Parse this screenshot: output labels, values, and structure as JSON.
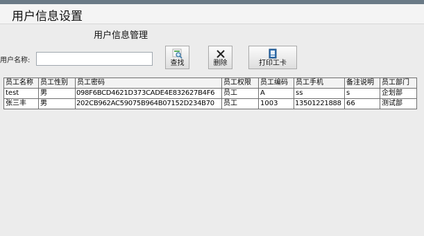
{
  "window": {
    "title": "用户信息设置"
  },
  "section": {
    "title": "用户信息管理"
  },
  "search": {
    "label": "用户名称:",
    "value": "",
    "placeholder": ""
  },
  "toolbar": {
    "find_label": "查找",
    "delete_label": "删除",
    "print_label": "打印工卡"
  },
  "icons": {
    "find": "magnifier-icon",
    "delete": "close-x-icon",
    "print": "badge-card-icon"
  },
  "colors": {
    "title_bar": "#f4f4f4",
    "background": "#ececec",
    "grid_border": "#6f6f6f"
  },
  "table": {
    "headers": [
      "员工名称",
      "员工性别",
      "员工密码",
      "员工权限",
      "员工编码",
      "员工手机",
      "备注说明",
      "员工部门"
    ],
    "rows": [
      [
        "test",
        "男",
        "098F6BCD4621D373CADE4E832627B4F6",
        "员工",
        "A",
        "ss",
        "s",
        "企划部"
      ],
      [
        "张三丰",
        "男",
        "202CB962AC59075B964B07152D234B70",
        "员工",
        "1003",
        "13501221888",
        "66",
        "测试部"
      ]
    ]
  }
}
